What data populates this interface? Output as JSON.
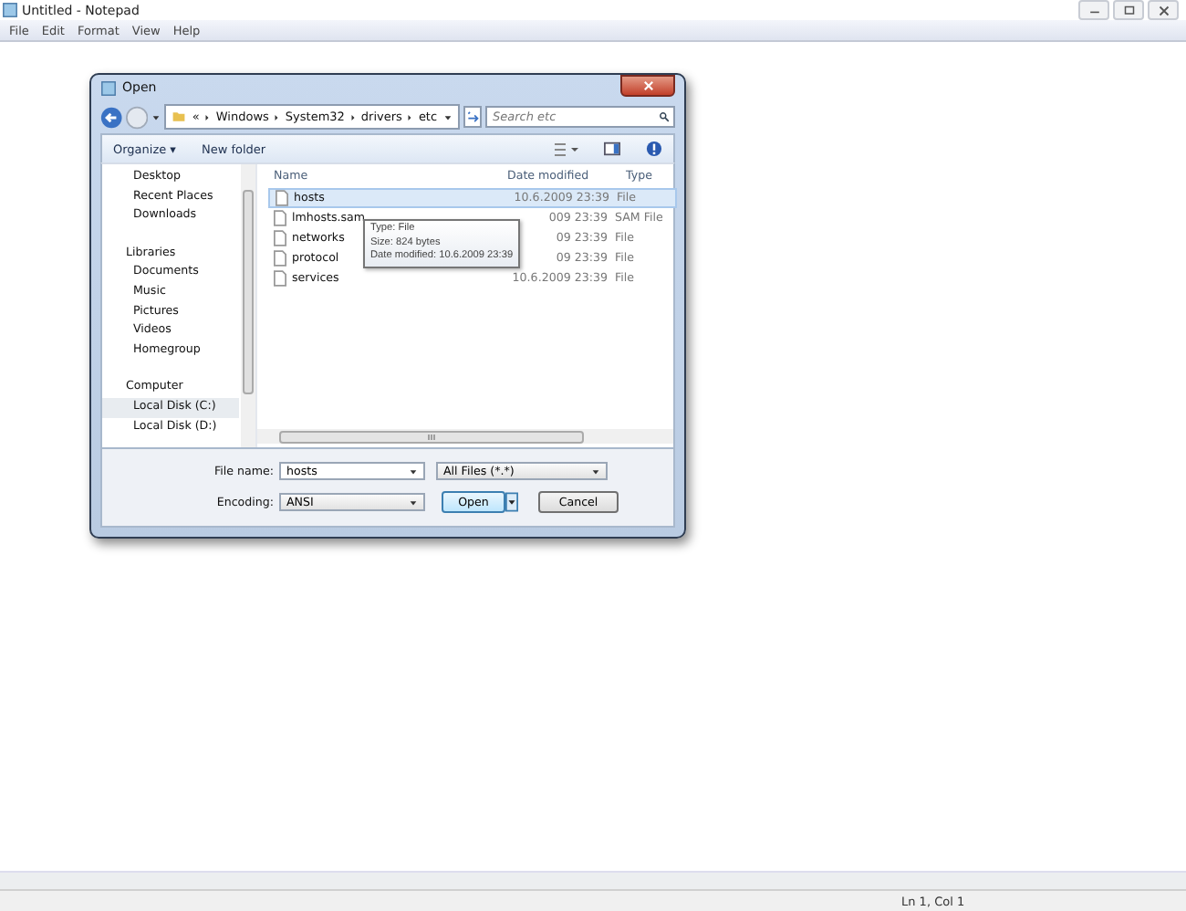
{
  "window": {
    "title": "Untitled - Notepad"
  },
  "menu": [
    "File",
    "Edit",
    "Format",
    "View",
    "Help"
  ],
  "dialog": {
    "title": "Open",
    "breadcrumb": [
      "«",
      "Windows",
      "System32",
      "drivers",
      "etc"
    ],
    "search": {
      "placeholder": "Search etc"
    },
    "toolbar": [
      "Organize ▾",
      "New folder"
    ],
    "sidebar": {
      "items": [
        {
          "label": "Desktop",
          "selected": false
        },
        {
          "label": "Recent Places",
          "selected": false
        },
        {
          "label": "Downloads",
          "selected": false
        },
        {
          "label": "Libraries",
          "selected": false,
          "children": [
            {
              "label": "Documents",
              "selected": false
            },
            {
              "label": "Music",
              "selected": false
            },
            {
              "label": "Pictures",
              "selected": false
            },
            {
              "label": "Videos",
              "selected": false
            }
          ]
        },
        {
          "label": "Homegroup",
          "selected": false
        },
        {
          "label": "Computer",
          "selected": false,
          "children": [
            {
              "label": "Local Disk (C:)",
              "selected": true
            },
            {
              "label": "Local Disk (D:)",
              "selected": false
            }
          ]
        }
      ]
    },
    "columns": [
      "Name",
      "Date modified",
      "Type"
    ],
    "rows": [
      {
        "name": "hosts",
        "date": "10.6.2009 23:39",
        "type": "File",
        "selected": true
      },
      {
        "name": "lmhosts.sam",
        "date": "009 23:39",
        "type": "SAM File",
        "selected": false
      },
      {
        "name": "networks",
        "date": "09 23:39",
        "type": "File",
        "selected": false
      },
      {
        "name": "protocol",
        "date": "09 23:39",
        "type": "File",
        "selected": false
      },
      {
        "name": "services",
        "date": "10.6.2009 23:39",
        "type": "File",
        "selected": false
      }
    ],
    "tooltip": [
      "Type: File",
      "Size: 824 bytes",
      "Date modified: 10.6.2009 23:39"
    ],
    "file_name": {
      "label": "File name:",
      "value": "hosts"
    },
    "filter": "All Files  (*.*)",
    "encoding": {
      "label": "Encoding:",
      "value": "ANSI"
    },
    "buttons": [
      "Open",
      "Cancel"
    ]
  },
  "status_bar": "Ln 1, Col 1"
}
